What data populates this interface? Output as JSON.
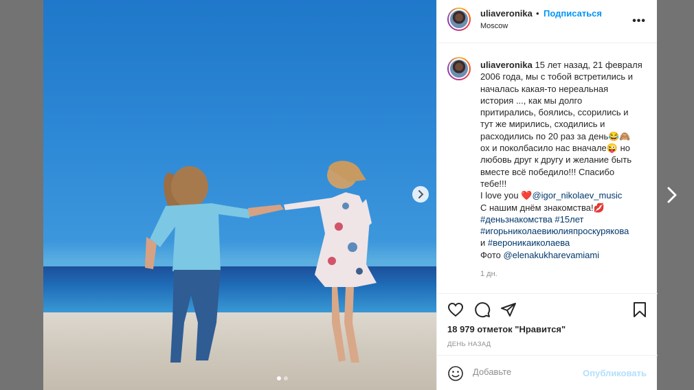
{
  "post": {
    "username": "uliaveronika",
    "separator": "•",
    "follow_label": "Подписаться",
    "location": "Moscow",
    "more_label": "•••"
  },
  "caption": {
    "username": "uliaveronika",
    "lines": [
      "15 лет назад, 21 февраля",
      "2006 года, мы с тобой встретились и",
      "началась какая-то нереальная",
      "история ..., как мы долго",
      "притирались, боялись, ссорились и",
      "тут же мирились, сходились и",
      "расходились по 20 раз за день😂🙈",
      "ох и поколбасило нас вначале😜 но",
      "любовь друг к другу и желание быть",
      "вместе всё победило!!! Спасибо",
      "тебе!!!"
    ],
    "love_prefix": "I love you ",
    "heart": "❤️",
    "mention": "@igor_nikolaev_music",
    "line_meeting": "С нашим днём знакомства!💋",
    "tags_line1": "#деньзнакомства #15лет",
    "tags_line2": "#игорьниколаевиюлияпроскурякова",
    "and_word": "и ",
    "tags_line3": "#вероникаиколаева",
    "photo_prefix": "Фото ",
    "photo_mention": "@elenakukharevamiami",
    "time_ago": "1 дн."
  },
  "actions": {
    "like_icon": "heart-outline-icon",
    "comment_icon": "comment-bubble-icon",
    "share_icon": "paper-plane-icon",
    "save_icon": "bookmark-icon",
    "likes_text": "18 979 отметок \"Нравится\"",
    "date_text": "ДЕНЬ НАЗАД"
  },
  "comment": {
    "placeholder": "Добавьте",
    "publish_label": "Опубликовать"
  },
  "carousel": {
    "total": 2,
    "active": 1
  },
  "colors": {
    "accent": "#0095f6",
    "link": "#00376b",
    "backdrop": "#737373"
  }
}
